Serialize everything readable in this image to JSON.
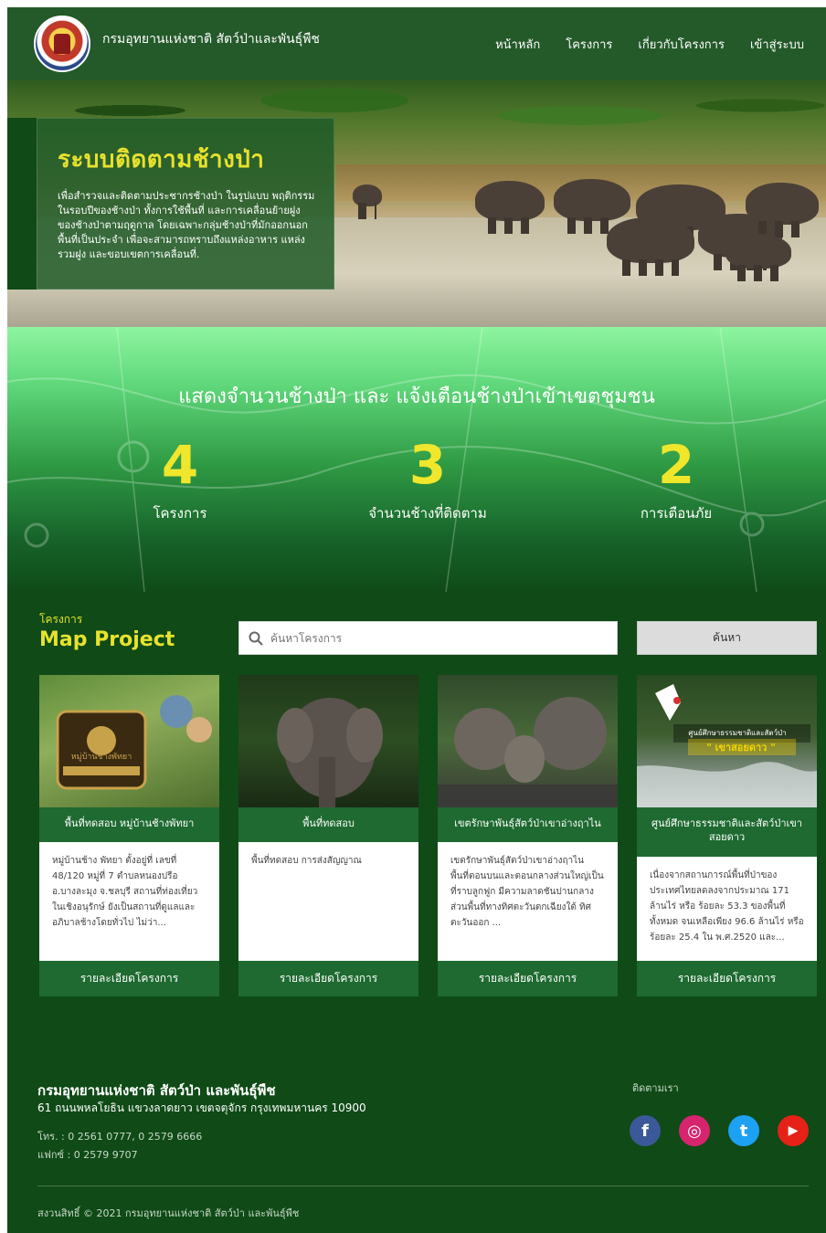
{
  "header": {
    "site_title": "กรมอุทยานแห่งชาติ สัตว์ป่าและพันธุ์พืช",
    "nav": [
      "หน้าหลัก",
      "โครงการ",
      "เกี่ยวกับโครงการ",
      "เข้าสู่ระบบ"
    ]
  },
  "hero": {
    "title": "ระบบติดตามช้างป่า",
    "description": "เพื่อสำรวจและติดตามประชากรช้างป่า ในรูปแบบ พฤติกรรมในรอบปีของช้างป่า ทั้งการใช้พื้นที่ และการเคลื่อนย้ายฝูงของช้างป่าตามฤดูกาล โดยเฉพาะกลุ่มช้างป่าที่มักออกนอกพื้นที่เป็นประจำ เพื่อจะสามารถทราบถึงแหล่งอาหาร แหล่งรวมฝูง และขอบเขตการเคลื่อนที่."
  },
  "stats": {
    "title": "แสดงจำนวนช้างป่า และ แจ้งเตือนช้างป่าเข้าเขตชุมชน",
    "items": [
      {
        "value": "4",
        "label": "โครงการ"
      },
      {
        "value": "3",
        "label": "จำนวนช้างที่ติดตาม"
      },
      {
        "value": "2",
        "label": "การเตือนภัย"
      }
    ]
  },
  "project": {
    "kicker": "โครงการ",
    "title": "Map Project",
    "search_placeholder": "ค้นหาโครงการ",
    "search_button": "ค้นหา",
    "cards": [
      {
        "title": "พื้นที่ทดสอบ หมู่บ้านช้างพัทยา",
        "text": "หมู่บ้านช้าง พัทยา ตั้งอยู่ที่ เลขที่ 48/120 หมู่ที่ 7 ตำบลหนองปรือ อ.บางละมุง จ.ชลบุรี สถานที่ท่องเที่ยวในเชิงอนุรักษ์ ยังเป็นสถานที่ดูแลและอภิบาลช้างโดยทั่วไป ไม่ว่า...",
        "button": "รายละเอียดโครงการ",
        "image_caption": "หมู่บ้านช้างพัทยา"
      },
      {
        "title": "พื้นที่ทดสอบ",
        "text": "พื้นที่ทดสอบ การส่งสัญญาณ",
        "button": "รายละเอียดโครงการ"
      },
      {
        "title": "เขตรักษาพันธุ์สัตว์ป่าเขาอ่างฤาไน",
        "text": "เขตรักษาพันธุ์สัตว์ป่าเขาอ่างฤาไน พื้นที่ตอนบนและตอนกลางส่วนใหญ่เป็นที่ราบลูกฟูก มีความลาดชันปานกลาง ส่วนพื้นที่ทางทิศตะวันตกเฉียงใต้ ทิศตะวันออก ...",
        "button": "รายละเอียดโครงการ"
      },
      {
        "title": "ศูนย์ศึกษาธรรมชาติและสัตว์ป่าเขาสอยดาว",
        "text": "เนื่องจากสถานการณ์พื้นที่ป่าของประเทศไทยลดลงจากประมาณ 171 ล้านไร่ หรือ ร้อยละ 53.3 ของพื้นที่ทั้งหมด จนเหลือเพียง 96.6 ล้านไร่ หรือ ร้อยละ 25.4 ใน พ.ศ.2520 และ...",
        "button": "รายละเอียดโครงการ",
        "image_caption": "ศูนย์ศึกษาธรรมชาติและสัตว์ป่า",
        "image_caption2": "\" เขาสอยดาว \""
      }
    ]
  },
  "footer": {
    "org": "กรมอุทยานแห่งชาติ สัตว์ป่า และพันธุ์พืช",
    "address": "61 ถนนพหลโยธิน แขวงลาดยาว เขตจตุจักร กรุงเทพมหานคร 10900",
    "tel": "โทร. : 0 2561 0777, 0 2579 6666",
    "fax": "แฟกซ์ : 0 2579 9707",
    "follow": "ติดตามเรา",
    "socials": [
      {
        "name": "facebook-icon",
        "glyph": "f",
        "color": "#3b5998"
      },
      {
        "name": "instagram-icon",
        "glyph": "◎",
        "color": "#d6246e"
      },
      {
        "name": "twitter-icon",
        "glyph": "t",
        "color": "#1da1f2"
      },
      {
        "name": "youtube-icon",
        "glyph": "▶",
        "color": "#e62117"
      }
    ],
    "copyright": "สงวนสิทธิ์ © 2021 กรมอุทยานแห่งชาติ สัตว์ป่า และพันธุ์พืช"
  },
  "colors": {
    "brand_dark": "#0f4a17",
    "accent_yellow": "#e8e22d",
    "card_green": "#1e6a31"
  }
}
